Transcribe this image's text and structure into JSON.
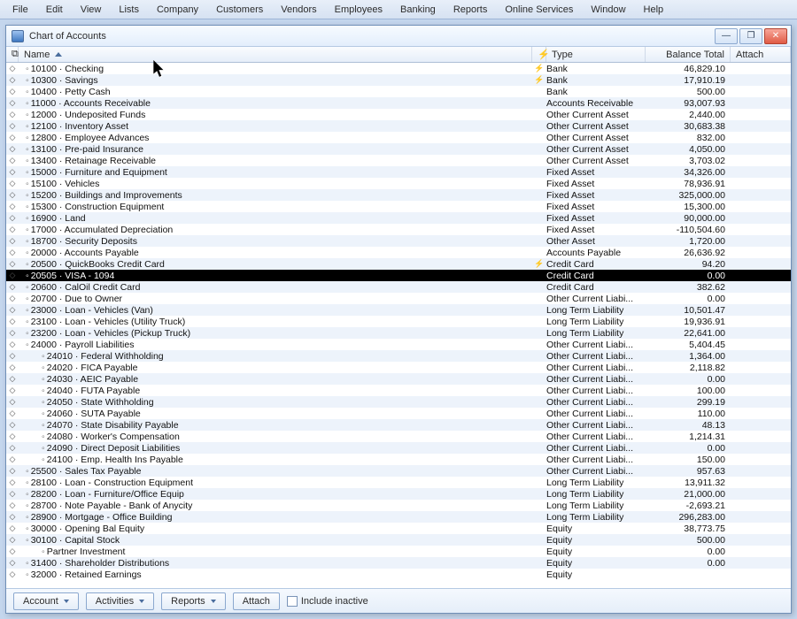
{
  "menubar": [
    "File",
    "Edit",
    "View",
    "Lists",
    "Company",
    "Customers",
    "Vendors",
    "Employees",
    "Banking",
    "Reports",
    "Online Services",
    "Window",
    "Help"
  ],
  "window": {
    "title": "Chart of Accounts",
    "columns": {
      "name": "Name",
      "type": "Type",
      "balance": "Balance Total",
      "attach": "Attach"
    },
    "selected_index": 18,
    "rows": [
      {
        "indent": 0,
        "name": "10100 · Checking",
        "type": "Bank",
        "bal": "46,829.10",
        "flag": true
      },
      {
        "indent": 0,
        "name": "10300 · Savings",
        "type": "Bank",
        "bal": "17,910.19",
        "flag": true
      },
      {
        "indent": 0,
        "name": "10400 · Petty Cash",
        "type": "Bank",
        "bal": "500.00"
      },
      {
        "indent": 0,
        "name": "11000 · Accounts Receivable",
        "type": "Accounts Receivable",
        "bal": "93,007.93"
      },
      {
        "indent": 0,
        "name": "12000 · Undeposited Funds",
        "type": "Other Current Asset",
        "bal": "2,440.00"
      },
      {
        "indent": 0,
        "name": "12100 · Inventory Asset",
        "type": "Other Current Asset",
        "bal": "30,683.38"
      },
      {
        "indent": 0,
        "name": "12800 · Employee Advances",
        "type": "Other Current Asset",
        "bal": "832.00"
      },
      {
        "indent": 0,
        "name": "13100 · Pre-paid Insurance",
        "type": "Other Current Asset",
        "bal": "4,050.00"
      },
      {
        "indent": 0,
        "name": "13400 · Retainage Receivable",
        "type": "Other Current Asset",
        "bal": "3,703.02"
      },
      {
        "indent": 0,
        "name": "15000 · Furniture and Equipment",
        "type": "Fixed Asset",
        "bal": "34,326.00"
      },
      {
        "indent": 0,
        "name": "15100 · Vehicles",
        "type": "Fixed Asset",
        "bal": "78,936.91"
      },
      {
        "indent": 0,
        "name": "15200 · Buildings and Improvements",
        "type": "Fixed Asset",
        "bal": "325,000.00"
      },
      {
        "indent": 0,
        "name": "15300 · Construction Equipment",
        "type": "Fixed Asset",
        "bal": "15,300.00"
      },
      {
        "indent": 0,
        "name": "16900 · Land",
        "type": "Fixed Asset",
        "bal": "90,000.00"
      },
      {
        "indent": 0,
        "name": "17000 · Accumulated Depreciation",
        "type": "Fixed Asset",
        "bal": "-110,504.60"
      },
      {
        "indent": 0,
        "name": "18700 · Security Deposits",
        "type": "Other Asset",
        "bal": "1,720.00"
      },
      {
        "indent": 0,
        "name": "20000 · Accounts Payable",
        "type": "Accounts Payable",
        "bal": "26,636.92"
      },
      {
        "indent": 0,
        "name": "20500 · QuickBooks Credit Card",
        "type": "Credit Card",
        "bal": "94.20",
        "flag": true
      },
      {
        "indent": 0,
        "name": "20505 · VISA - 1094",
        "type": "Credit Card",
        "bal": "0.00"
      },
      {
        "indent": 0,
        "name": "20600 · CalOil Credit Card",
        "type": "Credit Card",
        "bal": "382.62"
      },
      {
        "indent": 0,
        "name": "20700 · Due to Owner",
        "type": "Other Current Liabi...",
        "bal": "0.00"
      },
      {
        "indent": 0,
        "name": "23000 · Loan - Vehicles (Van)",
        "type": "Long Term Liability",
        "bal": "10,501.47"
      },
      {
        "indent": 0,
        "name": "23100 · Loan - Vehicles (Utility Truck)",
        "type": "Long Term Liability",
        "bal": "19,936.91"
      },
      {
        "indent": 0,
        "name": "23200 · Loan - Vehicles (Pickup Truck)",
        "type": "Long Term Liability",
        "bal": "22,641.00"
      },
      {
        "indent": 0,
        "name": "24000 · Payroll Liabilities",
        "type": "Other Current Liabi...",
        "bal": "5,404.45"
      },
      {
        "indent": 1,
        "name": "24010 · Federal Withholding",
        "type": "Other Current Liabi...",
        "bal": "1,364.00"
      },
      {
        "indent": 1,
        "name": "24020 · FICA Payable",
        "type": "Other Current Liabi...",
        "bal": "2,118.82"
      },
      {
        "indent": 1,
        "name": "24030 · AEIC Payable",
        "type": "Other Current Liabi...",
        "bal": "0.00"
      },
      {
        "indent": 1,
        "name": "24040 · FUTA Payable",
        "type": "Other Current Liabi...",
        "bal": "100.00"
      },
      {
        "indent": 1,
        "name": "24050 · State Withholding",
        "type": "Other Current Liabi...",
        "bal": "299.19"
      },
      {
        "indent": 1,
        "name": "24060 · SUTA Payable",
        "type": "Other Current Liabi...",
        "bal": "110.00"
      },
      {
        "indent": 1,
        "name": "24070 · State Disability Payable",
        "type": "Other Current Liabi...",
        "bal": "48.13"
      },
      {
        "indent": 1,
        "name": "24080 · Worker's Compensation",
        "type": "Other Current Liabi...",
        "bal": "1,214.31"
      },
      {
        "indent": 1,
        "name": "24090 · Direct Deposit Liabilities",
        "type": "Other Current Liabi...",
        "bal": "0.00"
      },
      {
        "indent": 1,
        "name": "24100 · Emp. Health Ins Payable",
        "type": "Other Current Liabi...",
        "bal": "150.00"
      },
      {
        "indent": 0,
        "name": "25500 · Sales Tax Payable",
        "type": "Other Current Liabi...",
        "bal": "957.63"
      },
      {
        "indent": 0,
        "name": "28100 · Loan - Construction Equipment",
        "type": "Long Term Liability",
        "bal": "13,911.32"
      },
      {
        "indent": 0,
        "name": "28200 · Loan - Furniture/Office Equip",
        "type": "Long Term Liability",
        "bal": "21,000.00"
      },
      {
        "indent": 0,
        "name": "28700 · Note Payable - Bank of Anycity",
        "type": "Long Term Liability",
        "bal": "-2,693.21"
      },
      {
        "indent": 0,
        "name": "28900 · Mortgage - Office Building",
        "type": "Long Term Liability",
        "bal": "296,283.00"
      },
      {
        "indent": 0,
        "name": "30000 · Opening Bal Equity",
        "type": "Equity",
        "bal": "38,773.75"
      },
      {
        "indent": 0,
        "name": "30100 · Capital Stock",
        "type": "Equity",
        "bal": "500.00"
      },
      {
        "indent": 1,
        "name": "Partner Investment",
        "type": "Equity",
        "bal": "0.00"
      },
      {
        "indent": 0,
        "name": "31400 · Shareholder Distributions",
        "type": "Equity",
        "bal": "0.00"
      },
      {
        "indent": 0,
        "name": "32000 · Retained Earnings",
        "type": "Equity",
        "bal": ""
      }
    ],
    "footer": {
      "account": "Account",
      "activities": "Activities",
      "reports": "Reports",
      "attach": "Attach",
      "include_inactive": "Include inactive"
    }
  }
}
